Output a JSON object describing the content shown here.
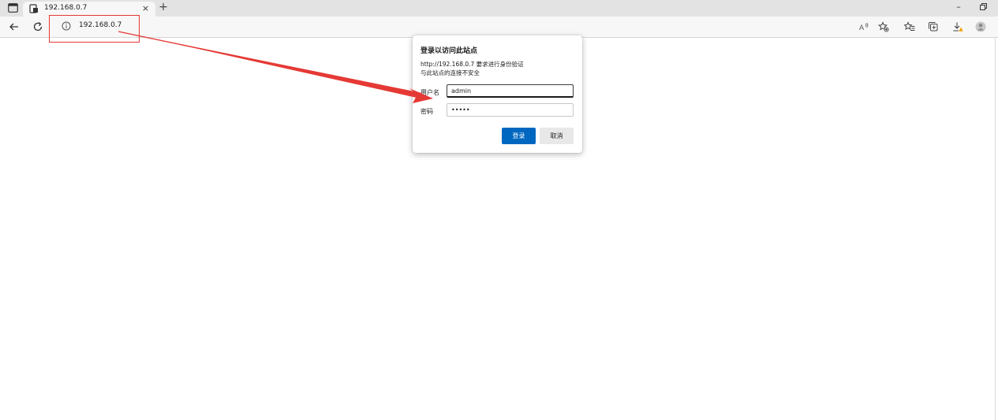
{
  "tab": {
    "title": "192.168.0.7",
    "close_glyph": "×",
    "new_tab_glyph": "+"
  },
  "window": {
    "minimize_glyph": "–"
  },
  "address_bar": {
    "url": "192.168.0.7",
    "info_icon": "info-icon"
  },
  "toolbar_icons": [
    "back-arrow-icon",
    "refresh-icon",
    "read-aloud-icon",
    "add-favorite-icon",
    "favorites-icon",
    "collections-icon",
    "downloads-icon",
    "profile-icon"
  ],
  "dialog": {
    "title": "登录以访问此站点",
    "message_line1": "http://192.168.0.7 要求进行身份验证",
    "message_line2": "与此站点的连接不安全",
    "username_label": "用户名",
    "username_value": "admin",
    "password_label": "密码",
    "password_value": "•••••",
    "login_button": "登录",
    "cancel_button": "取消"
  },
  "colors": {
    "annotation_red": "#e53935",
    "primary_button": "#0067c0",
    "tabstrip_bg": "#e3e3e3",
    "download_badge": "#f0a30a"
  }
}
